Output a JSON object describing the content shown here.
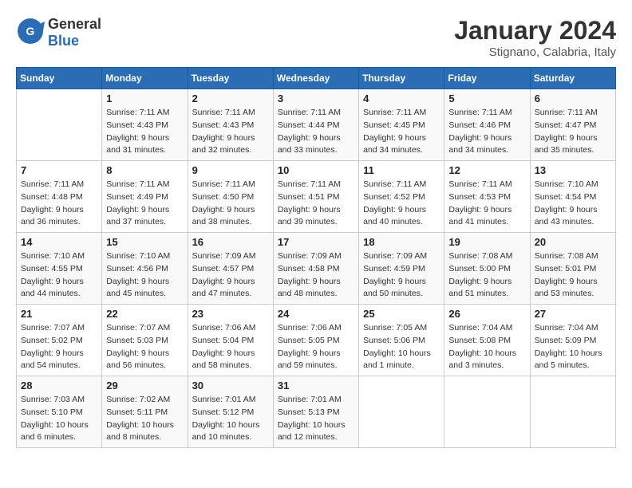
{
  "header": {
    "logo_general": "General",
    "logo_blue": "Blue",
    "month": "January 2024",
    "location": "Stignano, Calabria, Italy"
  },
  "days_of_week": [
    "Sunday",
    "Monday",
    "Tuesday",
    "Wednesday",
    "Thursday",
    "Friday",
    "Saturday"
  ],
  "weeks": [
    [
      {
        "day": "",
        "info": ""
      },
      {
        "day": "1",
        "info": "Sunrise: 7:11 AM\nSunset: 4:43 PM\nDaylight: 9 hours\nand 31 minutes."
      },
      {
        "day": "2",
        "info": "Sunrise: 7:11 AM\nSunset: 4:43 PM\nDaylight: 9 hours\nand 32 minutes."
      },
      {
        "day": "3",
        "info": "Sunrise: 7:11 AM\nSunset: 4:44 PM\nDaylight: 9 hours\nand 33 minutes."
      },
      {
        "day": "4",
        "info": "Sunrise: 7:11 AM\nSunset: 4:45 PM\nDaylight: 9 hours\nand 34 minutes."
      },
      {
        "day": "5",
        "info": "Sunrise: 7:11 AM\nSunset: 4:46 PM\nDaylight: 9 hours\nand 34 minutes."
      },
      {
        "day": "6",
        "info": "Sunrise: 7:11 AM\nSunset: 4:47 PM\nDaylight: 9 hours\nand 35 minutes."
      }
    ],
    [
      {
        "day": "7",
        "info": "Sunrise: 7:11 AM\nSunset: 4:48 PM\nDaylight: 9 hours\nand 36 minutes."
      },
      {
        "day": "8",
        "info": "Sunrise: 7:11 AM\nSunset: 4:49 PM\nDaylight: 9 hours\nand 37 minutes."
      },
      {
        "day": "9",
        "info": "Sunrise: 7:11 AM\nSunset: 4:50 PM\nDaylight: 9 hours\nand 38 minutes."
      },
      {
        "day": "10",
        "info": "Sunrise: 7:11 AM\nSunset: 4:51 PM\nDaylight: 9 hours\nand 39 minutes."
      },
      {
        "day": "11",
        "info": "Sunrise: 7:11 AM\nSunset: 4:52 PM\nDaylight: 9 hours\nand 40 minutes."
      },
      {
        "day": "12",
        "info": "Sunrise: 7:11 AM\nSunset: 4:53 PM\nDaylight: 9 hours\nand 41 minutes."
      },
      {
        "day": "13",
        "info": "Sunrise: 7:10 AM\nSunset: 4:54 PM\nDaylight: 9 hours\nand 43 minutes."
      }
    ],
    [
      {
        "day": "14",
        "info": "Sunrise: 7:10 AM\nSunset: 4:55 PM\nDaylight: 9 hours\nand 44 minutes."
      },
      {
        "day": "15",
        "info": "Sunrise: 7:10 AM\nSunset: 4:56 PM\nDaylight: 9 hours\nand 45 minutes."
      },
      {
        "day": "16",
        "info": "Sunrise: 7:09 AM\nSunset: 4:57 PM\nDaylight: 9 hours\nand 47 minutes."
      },
      {
        "day": "17",
        "info": "Sunrise: 7:09 AM\nSunset: 4:58 PM\nDaylight: 9 hours\nand 48 minutes."
      },
      {
        "day": "18",
        "info": "Sunrise: 7:09 AM\nSunset: 4:59 PM\nDaylight: 9 hours\nand 50 minutes."
      },
      {
        "day": "19",
        "info": "Sunrise: 7:08 AM\nSunset: 5:00 PM\nDaylight: 9 hours\nand 51 minutes."
      },
      {
        "day": "20",
        "info": "Sunrise: 7:08 AM\nSunset: 5:01 PM\nDaylight: 9 hours\nand 53 minutes."
      }
    ],
    [
      {
        "day": "21",
        "info": "Sunrise: 7:07 AM\nSunset: 5:02 PM\nDaylight: 9 hours\nand 54 minutes."
      },
      {
        "day": "22",
        "info": "Sunrise: 7:07 AM\nSunset: 5:03 PM\nDaylight: 9 hours\nand 56 minutes."
      },
      {
        "day": "23",
        "info": "Sunrise: 7:06 AM\nSunset: 5:04 PM\nDaylight: 9 hours\nand 58 minutes."
      },
      {
        "day": "24",
        "info": "Sunrise: 7:06 AM\nSunset: 5:05 PM\nDaylight: 9 hours\nand 59 minutes."
      },
      {
        "day": "25",
        "info": "Sunrise: 7:05 AM\nSunset: 5:06 PM\nDaylight: 10 hours\nand 1 minute."
      },
      {
        "day": "26",
        "info": "Sunrise: 7:04 AM\nSunset: 5:08 PM\nDaylight: 10 hours\nand 3 minutes."
      },
      {
        "day": "27",
        "info": "Sunrise: 7:04 AM\nSunset: 5:09 PM\nDaylight: 10 hours\nand 5 minutes."
      }
    ],
    [
      {
        "day": "28",
        "info": "Sunrise: 7:03 AM\nSunset: 5:10 PM\nDaylight: 10 hours\nand 6 minutes."
      },
      {
        "day": "29",
        "info": "Sunrise: 7:02 AM\nSunset: 5:11 PM\nDaylight: 10 hours\nand 8 minutes."
      },
      {
        "day": "30",
        "info": "Sunrise: 7:01 AM\nSunset: 5:12 PM\nDaylight: 10 hours\nand 10 minutes."
      },
      {
        "day": "31",
        "info": "Sunrise: 7:01 AM\nSunset: 5:13 PM\nDaylight: 10 hours\nand 12 minutes."
      },
      {
        "day": "",
        "info": ""
      },
      {
        "day": "",
        "info": ""
      },
      {
        "day": "",
        "info": ""
      }
    ]
  ]
}
